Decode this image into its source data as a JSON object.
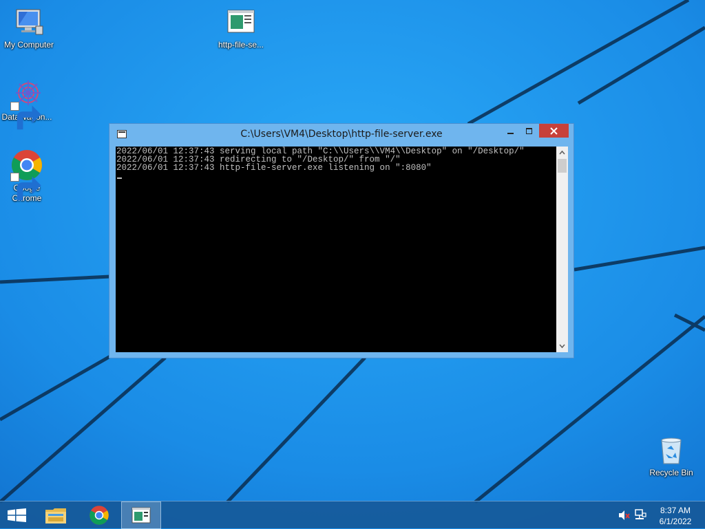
{
  "desktop": {
    "icons": [
      {
        "label": "My Computer",
        "icon": "computer-icon"
      },
      {
        "label": "http-file-se...",
        "icon": "console-app-icon"
      },
      {
        "label": "DataWagon...",
        "icon": "datawagon-icon"
      },
      {
        "label": "Google Chrome",
        "icon": "chrome-icon"
      },
      {
        "label": "Recycle Bin",
        "icon": "recycle-bin-icon"
      }
    ],
    "wallpaper_color": "#1d8fe8"
  },
  "console_window": {
    "title": "C:\\Users\\VM4\\Desktop\\http-file-server.exe",
    "lines": [
      "2022/06/01 12:37:43 serving local path \"C:\\\\Users\\\\VM4\\\\Desktop\" on \"/Desktop/\"",
      "2022/06/01 12:37:43 redirecting to \"/Desktop/\" from \"/\"",
      "2022/06/01 12:37:43 http-file-server.exe listening on \":8080\""
    ],
    "close_color": "#c7413a"
  },
  "taskbar": {
    "items": [
      "start-icon",
      "file-explorer-icon",
      "chrome-icon",
      "console-app-icon"
    ],
    "clock": {
      "time": "8:37 AM",
      "date": "6/1/2022"
    }
  }
}
